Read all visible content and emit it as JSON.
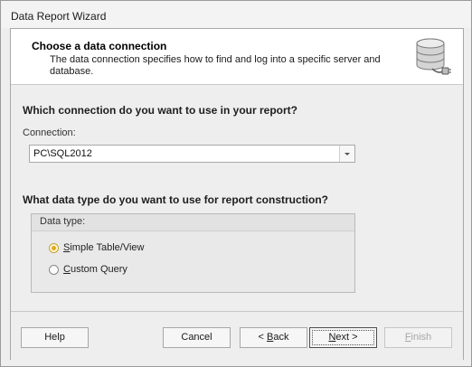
{
  "window": {
    "title": "Data Report Wizard"
  },
  "header": {
    "title": "Choose a data connection",
    "description": "The data connection specifies how to find and log into a specific server and database."
  },
  "connection": {
    "question": "Which connection do you want to use in your report?",
    "label": "Connection:",
    "value": "PC\\SQL2012"
  },
  "data_type": {
    "question": "What data type do you want to use for report construction?",
    "group_title": "Data type:",
    "options": [
      {
        "prefix": "",
        "mnemonic": "S",
        "rest": "imple Table/View",
        "checked": true
      },
      {
        "prefix": "",
        "mnemonic": "C",
        "rest": "ustom Query",
        "checked": false
      }
    ]
  },
  "buttons": {
    "help": "Help",
    "cancel": "Cancel",
    "back_prefix": "< ",
    "back_mnemonic": "B",
    "back_rest": "ack",
    "next_prefix": "",
    "next_mnemonic": "N",
    "next_rest": "ext >",
    "finish_mnemonic": "F",
    "finish_rest": "inish"
  }
}
